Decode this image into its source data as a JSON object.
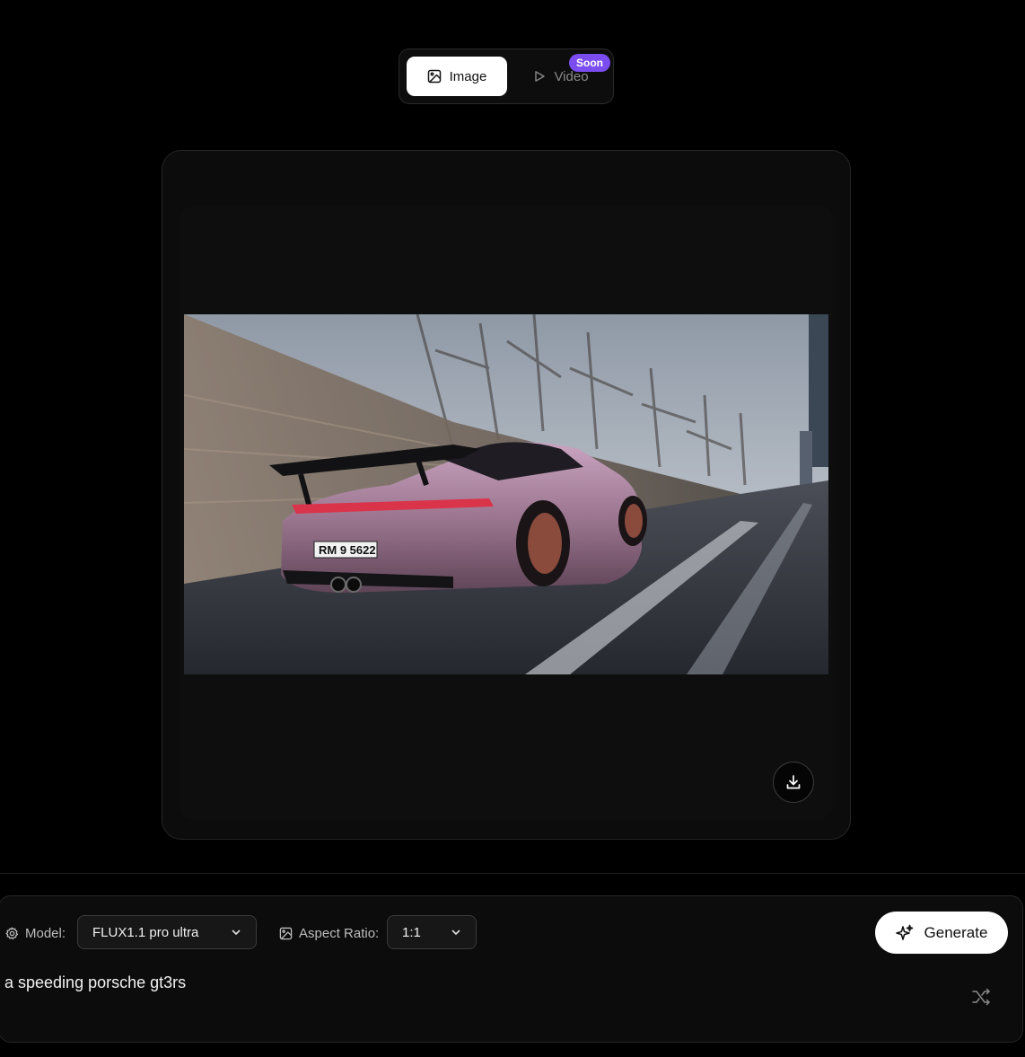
{
  "mode_toggle": {
    "image_label": "Image",
    "video_label": "Video",
    "soon_badge": "Soon",
    "selected": "Image"
  },
  "preview": {
    "image_alt": "Generated image of a pink Porsche GT3 RS speeding on a highway",
    "plate_text": "RM 9 5622",
    "download_icon": "download-icon"
  },
  "controls": {
    "model_label": "Model:",
    "model_value": "FLUX1.1 pro ultra",
    "aspect_label": "Aspect Ratio:",
    "aspect_value": "1:1",
    "generate_label": "Generate"
  },
  "prompt": {
    "value": "a speeding porsche gt3rs"
  },
  "colors": {
    "background": "#000000",
    "panel": "#0c0c0c",
    "badge": "#7b4df0",
    "button_bg": "#ffffff"
  }
}
